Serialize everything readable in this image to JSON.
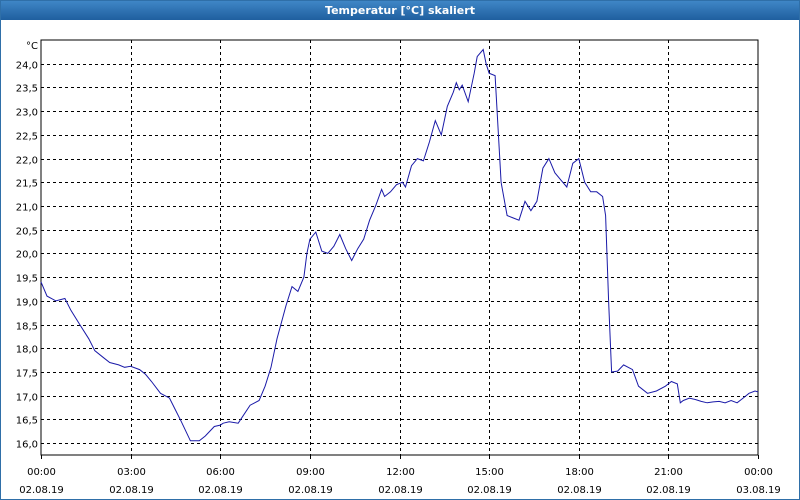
{
  "window": {
    "title": "Temperatur [°C] skaliert"
  },
  "chart_data": {
    "type": "line",
    "title": "Temperatur [°C] skaliert",
    "ylabel": "°C",
    "xlabel": "",
    "ylim": [
      15.75,
      24.5
    ],
    "xlim_hours": [
      0,
      24
    ],
    "grid": true,
    "line_color": "#1a1aa8",
    "y_ticks": [
      "16,0",
      "16,5",
      "17,0",
      "17,5",
      "18,0",
      "18,5",
      "19,0",
      "19,5",
      "20,0",
      "20,5",
      "21,0",
      "21,5",
      "22,0",
      "22,5",
      "23,0",
      "23,5",
      "24,0"
    ],
    "y_tick_values": [
      16.0,
      16.5,
      17.0,
      17.5,
      18.0,
      18.5,
      19.0,
      19.5,
      20.0,
      20.5,
      21.0,
      21.5,
      22.0,
      22.5,
      23.0,
      23.5,
      24.0
    ],
    "x_ticks": [
      {
        "hour": 0,
        "time": "00:00",
        "date": "02.08.19"
      },
      {
        "hour": 3,
        "time": "03:00",
        "date": "02.08.19"
      },
      {
        "hour": 6,
        "time": "06:00",
        "date": "02.08.19"
      },
      {
        "hour": 9,
        "time": "09:00",
        "date": "02.08.19"
      },
      {
        "hour": 12,
        "time": "12:00",
        "date": "02.08.19"
      },
      {
        "hour": 15,
        "time": "15:00",
        "date": "02.08.19"
      },
      {
        "hour": 18,
        "time": "18:00",
        "date": "02.08.19"
      },
      {
        "hour": 21,
        "time": "21:00",
        "date": "02.08.19"
      },
      {
        "hour": 24,
        "time": "00:00",
        "date": "03.08.19"
      }
    ],
    "series": [
      {
        "x_hours": [
          0.0,
          0.2,
          0.5,
          0.8,
          1.0,
          1.3,
          1.6,
          1.8,
          2.1,
          2.3,
          2.6,
          2.8,
          3.0,
          3.3,
          3.5,
          3.7,
          4.0,
          4.3,
          4.5,
          4.7,
          5.0,
          5.3,
          5.5,
          5.8,
          6.0,
          6.1,
          6.3,
          6.6,
          7.0,
          7.3,
          7.5,
          7.7,
          7.9,
          8.2,
          8.4,
          8.6,
          8.8,
          8.9,
          9.0,
          9.2,
          9.4,
          9.6,
          9.8,
          10.0,
          10.2,
          10.4,
          10.6,
          10.8,
          11.0,
          11.2,
          11.4,
          11.5,
          11.7,
          11.9,
          12.1,
          12.2,
          12.4,
          12.6,
          12.8,
          13.0,
          13.2,
          13.4,
          13.6,
          13.8,
          13.9,
          14.0,
          14.1,
          14.3,
          14.5,
          14.6,
          14.8,
          14.9,
          15.0,
          15.2,
          15.4,
          15.6,
          15.8,
          16.0,
          16.2,
          16.4,
          16.6,
          16.8,
          17.0,
          17.2,
          17.4,
          17.6,
          17.8,
          18.0,
          18.2,
          18.4,
          18.6,
          18.8,
          18.9,
          19.0,
          19.1,
          19.3,
          19.5,
          19.8,
          20.0,
          20.3,
          20.6,
          20.9,
          21.1,
          21.3,
          21.4,
          21.5,
          21.7,
          21.9,
          22.1,
          22.3,
          22.5,
          22.7,
          22.9,
          23.1,
          23.3,
          23.5,
          23.7,
          23.9,
          24.0
        ],
        "values": [
          19.4,
          19.1,
          19.0,
          19.05,
          18.8,
          18.5,
          18.2,
          17.95,
          17.8,
          17.7,
          17.65,
          17.6,
          17.62,
          17.55,
          17.45,
          17.3,
          17.05,
          16.95,
          16.7,
          16.45,
          16.05,
          16.05,
          16.15,
          16.35,
          16.38,
          16.42,
          16.45,
          16.42,
          16.8,
          16.9,
          17.2,
          17.6,
          18.2,
          18.9,
          19.3,
          19.2,
          19.5,
          20.0,
          20.3,
          20.45,
          20.05,
          20.0,
          20.15,
          20.4,
          20.1,
          19.85,
          20.1,
          20.3,
          20.7,
          21.0,
          21.35,
          21.2,
          21.3,
          21.45,
          21.5,
          21.4,
          21.85,
          22.0,
          21.95,
          22.35,
          22.8,
          22.5,
          23.1,
          23.4,
          23.6,
          23.45,
          23.55,
          23.2,
          23.8,
          24.15,
          24.3,
          24.0,
          23.8,
          23.75,
          21.5,
          20.8,
          20.75,
          20.7,
          21.1,
          20.9,
          21.1,
          21.8,
          22.0,
          21.7,
          21.55,
          21.4,
          21.9,
          22.0,
          21.5,
          21.3,
          21.3,
          21.2,
          20.8,
          19.0,
          17.5,
          17.52,
          17.65,
          17.55,
          17.2,
          17.05,
          17.1,
          17.2,
          17.3,
          17.25,
          16.85,
          16.9,
          16.95,
          16.92,
          16.88,
          16.85,
          16.87,
          16.88,
          16.85,
          16.9,
          16.85,
          16.95,
          17.05,
          17.1,
          17.08
        ]
      }
    ]
  }
}
